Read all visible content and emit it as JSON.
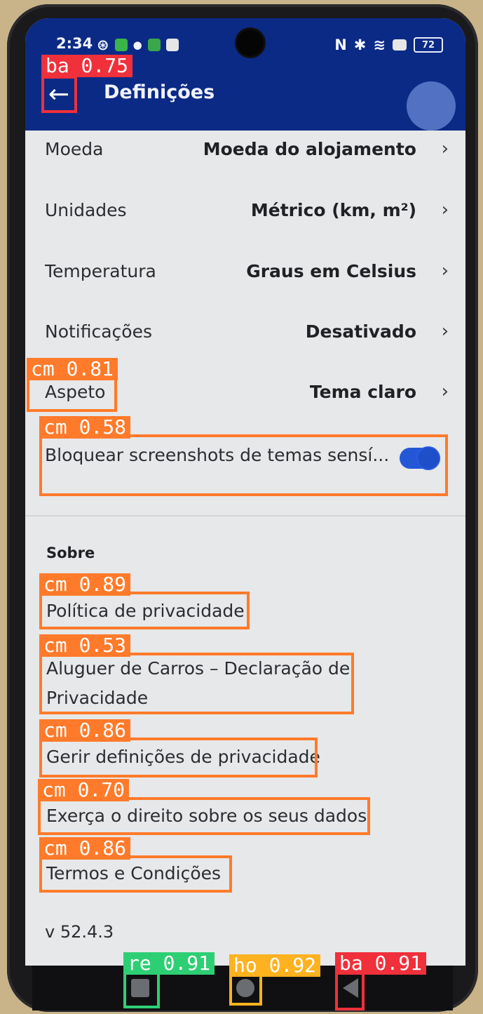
{
  "status_bar": {
    "time": "2:34",
    "battery": "72"
  },
  "app_bar": {
    "back_icon": "back-arrow-icon",
    "title": "Definições"
  },
  "settings": [
    {
      "label": "Moeda",
      "value": "Moeda do alojamento"
    },
    {
      "label": "Unidades",
      "value": "Métrico (km, m²)"
    },
    {
      "label": "Temperatura",
      "value": "Graus em Celsius"
    },
    {
      "label": "Notificações",
      "value": "Desativado"
    },
    {
      "label": "Aspeto",
      "value": "Tema claro"
    }
  ],
  "toggle": {
    "label": "Bloquear screenshots de temas sensí...",
    "enabled": true
  },
  "about": {
    "heading": "Sobre",
    "links": [
      "Política de privacidade",
      "Aluguer de Carros – Declaração de Privacidade",
      "Gerir definições de privacidade",
      "Exerça o direito sobre os seus dados",
      "Termos e Condições"
    ]
  },
  "version": "v 52.4.3",
  "detections": [
    {
      "text": "ba 0.75"
    },
    {
      "text": "cm 0.81"
    },
    {
      "text": "cm 0.58"
    },
    {
      "text": "cm 0.89"
    },
    {
      "text": "cm 0.53"
    },
    {
      "text": "cm 0.86"
    },
    {
      "text": "cm 0.70"
    },
    {
      "text": "cm 0.86"
    },
    {
      "text": "re 0.91"
    },
    {
      "text": "ho 0.92"
    },
    {
      "text": "ba 0.91"
    }
  ],
  "colors": {
    "app_bar": "#0b2a86",
    "toggle_on": "#2457d6",
    "det_back": "#f0303a",
    "det_content": "#ff7a2a",
    "det_recent": "#2ecf74",
    "det_home": "#ffb21f"
  }
}
